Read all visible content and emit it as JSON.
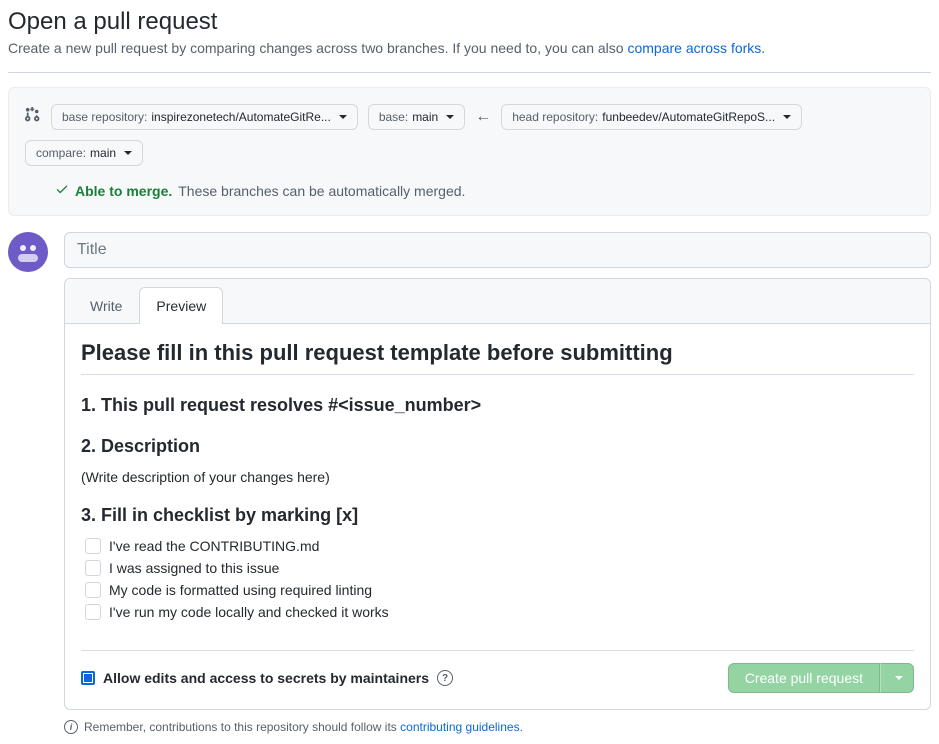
{
  "header": {
    "title": "Open a pull request",
    "subtitle_pre": "Create a new pull request by comparing changes across two branches. If you need to, you can also ",
    "subtitle_link": "compare across forks",
    "subtitle_post": "."
  },
  "compare": {
    "base_repo_label": "base repository:",
    "base_repo_value": "inspirezonetech/AutomateGitRe...",
    "base_branch_label": "base:",
    "base_branch_value": "main",
    "head_repo_label": "head repository:",
    "head_repo_value": "funbeedev/AutomateGitRepoS...",
    "compare_branch_label": "compare:",
    "compare_branch_value": "main"
  },
  "merge": {
    "able": "Able to merge.",
    "desc": "These branches can be automatically merged."
  },
  "form": {
    "title_placeholder": "Title",
    "tabs": {
      "write": "Write",
      "preview": "Preview"
    },
    "preview": {
      "h2": "Please fill in this pull request template before submitting",
      "h3_1": "1. This pull request resolves #<issue_number>",
      "h3_2": "2. Description",
      "desc_text": "(Write description of your changes here)",
      "h3_3": "3. Fill in checklist by marking [x]",
      "checklist": [
        "I've read the CONTRIBUTING.md",
        "I was assigned to this issue",
        "My code is formatted using required linting",
        "I've run my code locally and checked it works"
      ]
    },
    "allow_edits": "Allow edits and access to secrets by maintainers",
    "create_btn": "Create pull request"
  },
  "remember": {
    "pre": "Remember, contributions to this repository should follow its ",
    "link": "contributing guidelines",
    "post": "."
  }
}
